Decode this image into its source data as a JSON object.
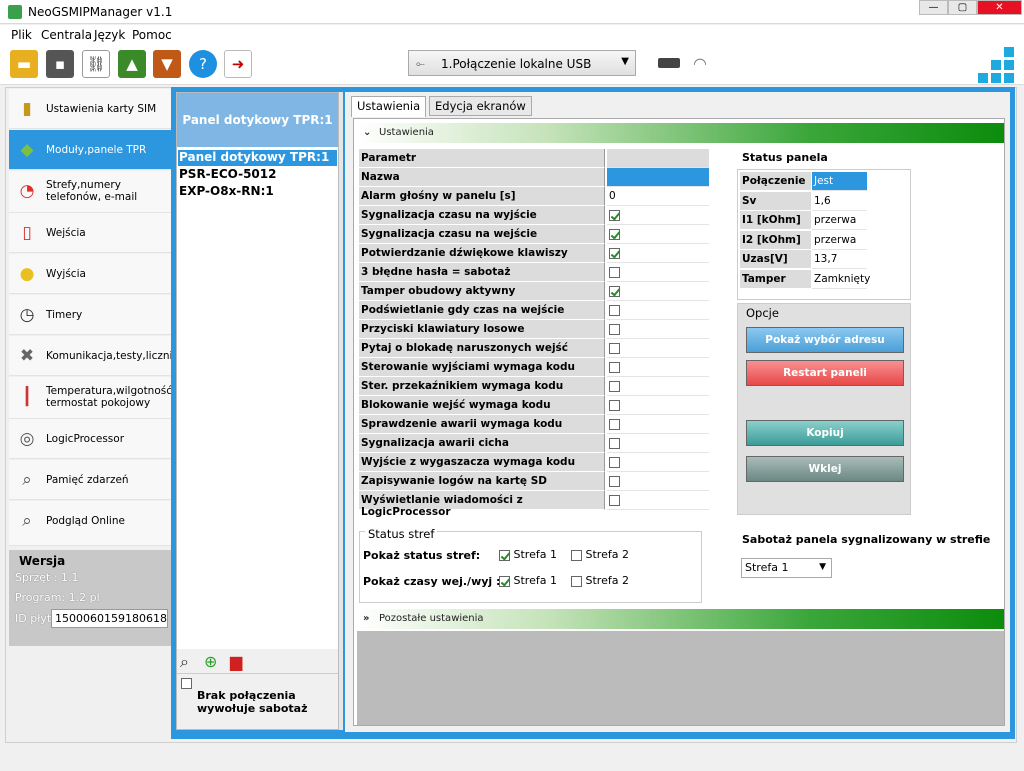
{
  "window": {
    "title": "NeoGSMIPManager v1.1",
    "minimize": "—",
    "maximize": "▢",
    "close": "✕"
  },
  "menu": [
    "Plik",
    "Centrala",
    "Język",
    "Pomoc"
  ],
  "toolbar": {
    "icons": [
      "folder-open-icon",
      "save-disk-icon",
      "disconnect-icon",
      "upload-chip-icon",
      "download-chip-icon",
      "help-icon",
      "exit-icon"
    ],
    "connection": "1.Połączenie lokalne USB"
  },
  "sidebar": {
    "items": [
      {
        "label": "Ustawienia karty SIM",
        "icon": "sim-card-icon"
      },
      {
        "label": "Moduły,panele TPR",
        "icon": "modules-cubes-icon",
        "active": true
      },
      {
        "label": "Strefy,numery telefonów, e-mail",
        "icon": "zones-ring-icon"
      },
      {
        "label": "Wejścia",
        "icon": "inputs-sensor-icon"
      },
      {
        "label": "Wyjścia",
        "icon": "outputs-bulb-icon"
      },
      {
        "label": "Timery",
        "icon": "timer-clock-icon"
      },
      {
        "label": "Komunikacja,testy,liczniki",
        "icon": "tools-wrench-icon"
      },
      {
        "label": "Temperatura,wilgotność, termostat pokojowy",
        "icon": "thermometer-icon"
      },
      {
        "label": "LogicProcessor",
        "icon": "logic-processor-icon"
      },
      {
        "label": "Pamięć zdarzeń",
        "icon": "event-memory-icon"
      },
      {
        "label": "Podgląd Online",
        "icon": "online-preview-icon"
      }
    ]
  },
  "version": {
    "title": "Wersja",
    "sprzet": "Sprzęt : 1.1",
    "program": "Program: 1.2 pl",
    "id_label": "ID płyty",
    "id_value": "1500060159180618"
  },
  "devices": {
    "header": "Panel dotykowy TPR:1",
    "items": [
      "Panel dotykowy TPR:1",
      "PSR-ECO-5012",
      "EXP-O8x-RN:1"
    ],
    "footer_label": "Brak połączenia wywołuje sabotaż"
  },
  "tabs": [
    "Ustawienia",
    "Edycja ekranów"
  ],
  "section_ustawienia": "Ustawienia",
  "section_pozostale": "Pozostałe ustawienia",
  "params": {
    "header": "Parametr",
    "rows": [
      {
        "label": "Nazwa",
        "type": "selected",
        "value": ""
      },
      {
        "label": "Alarm głośny w panelu [s]",
        "type": "text",
        "value": "0"
      },
      {
        "label": "Sygnalizacja czasu na wyjście",
        "type": "check",
        "value": true
      },
      {
        "label": "Sygnalizacja czasu na wejście",
        "type": "check",
        "value": true
      },
      {
        "label": "Potwierdzanie dźwiękowe klawiszy",
        "type": "check",
        "value": true
      },
      {
        "label": "3 błędne hasła = sabotaż",
        "type": "check",
        "value": false
      },
      {
        "label": "Tamper obudowy aktywny",
        "type": "check",
        "value": true
      },
      {
        "label": "Podświetlanie gdy czas na wejście",
        "type": "check",
        "value": false
      },
      {
        "label": "Przyciski klawiatury losowe",
        "type": "check",
        "value": false
      },
      {
        "label": "Pytaj o blokadę naruszonych wejść",
        "type": "check",
        "value": false
      },
      {
        "label": "Sterowanie wyjściami wymaga kodu",
        "type": "check",
        "value": false
      },
      {
        "label": "Ster. przekaźnikiem wymaga kodu",
        "type": "check",
        "value": false
      },
      {
        "label": "Blokowanie wejść wymaga kodu",
        "type": "check",
        "value": false
      },
      {
        "label": "Sprawdzenie awarii wymaga kodu",
        "type": "check",
        "value": false
      },
      {
        "label": "Sygnalizacja awarii cicha",
        "type": "check",
        "value": false
      },
      {
        "label": "Wyjście z wygaszacza wymaga kodu",
        "type": "check",
        "value": false
      },
      {
        "label": "Zapisywanie  logów na  kartę SD",
        "type": "check",
        "value": false
      },
      {
        "label": "Wyświetlanie wiadomości z LogicProcessor",
        "type": "check",
        "value": false
      }
    ]
  },
  "status": {
    "title": "Status panela",
    "rows": [
      {
        "label": "Połączenie",
        "value": "Jest"
      },
      {
        "label": "Sv",
        "value": "1,6"
      },
      {
        "label": "I1 [kOhm]",
        "value": "przerwa"
      },
      {
        "label": "I2 [kOhm]",
        "value": "przerwa"
      },
      {
        "label": "Uzas[V]",
        "value": "13,7"
      },
      {
        "label": "Tamper",
        "value": "Zamknięty"
      }
    ]
  },
  "opcje": {
    "title": "Opcje",
    "buttons": [
      "Pokaż wybór adresu",
      "Restart  paneli",
      "Kopiuj",
      "Wklej"
    ]
  },
  "strefy": {
    "title": "Status stref",
    "row1_label": "Pokaż status stref:",
    "row2_label": "Pokaż czasy wej./wyj :",
    "strefa1": "Strefa 1",
    "strefa2": "Strefa 2"
  },
  "sabotaz": {
    "title": "Sabotaż panela sygnalizowany w strefie",
    "selected": "Strefa 1"
  },
  "colors": {
    "accent": "#2c97de",
    "header_strip": "#7fb6e4",
    "green_bar": "#0c8c0c"
  }
}
